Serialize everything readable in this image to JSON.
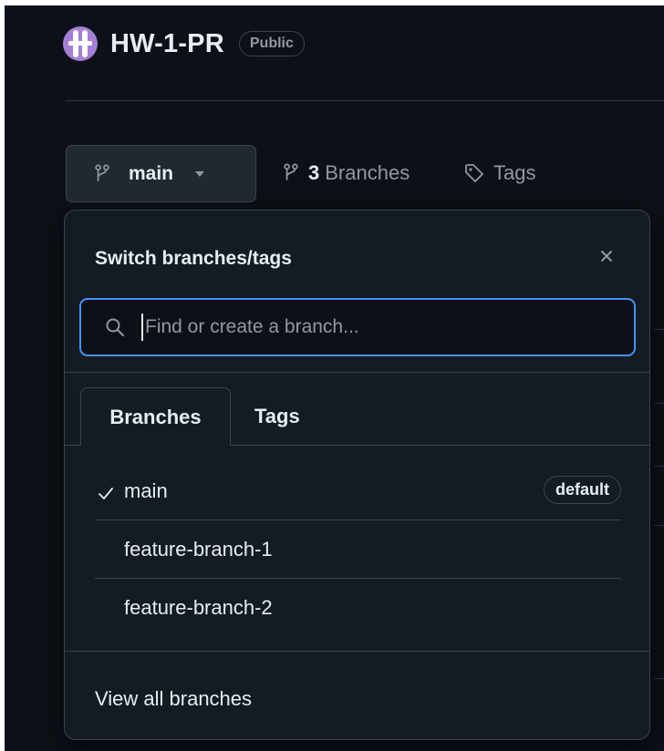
{
  "repo": {
    "name": "HW-1-PR",
    "visibility": "Public",
    "avatar_color": "#a47fd6"
  },
  "branch_bar": {
    "current_branch": "main",
    "branch_count": "3",
    "branches_label": "Branches",
    "tags_label": "Tags"
  },
  "popover": {
    "title": "Switch branches/tags",
    "search_placeholder": "Find or create a branch...",
    "tabs": [
      {
        "label": "Branches",
        "selected": true
      },
      {
        "label": "Tags",
        "selected": false
      }
    ],
    "branches": [
      {
        "name": "main",
        "checked": true,
        "badge": "default"
      },
      {
        "name": "feature-branch-1",
        "checked": false
      },
      {
        "name": "feature-branch-2",
        "checked": false
      }
    ],
    "view_all_label": "View all branches"
  },
  "icons": {
    "branch": "git-branch-icon",
    "tag": "tag-icon",
    "search": "search-icon",
    "close": "close-icon",
    "check": "check-icon",
    "caret": "chevron-down-icon"
  },
  "colors": {
    "background": "#0d1117",
    "overlay": "#151b23",
    "focus_ring": "#4493f8",
    "border": "#3d444d"
  }
}
